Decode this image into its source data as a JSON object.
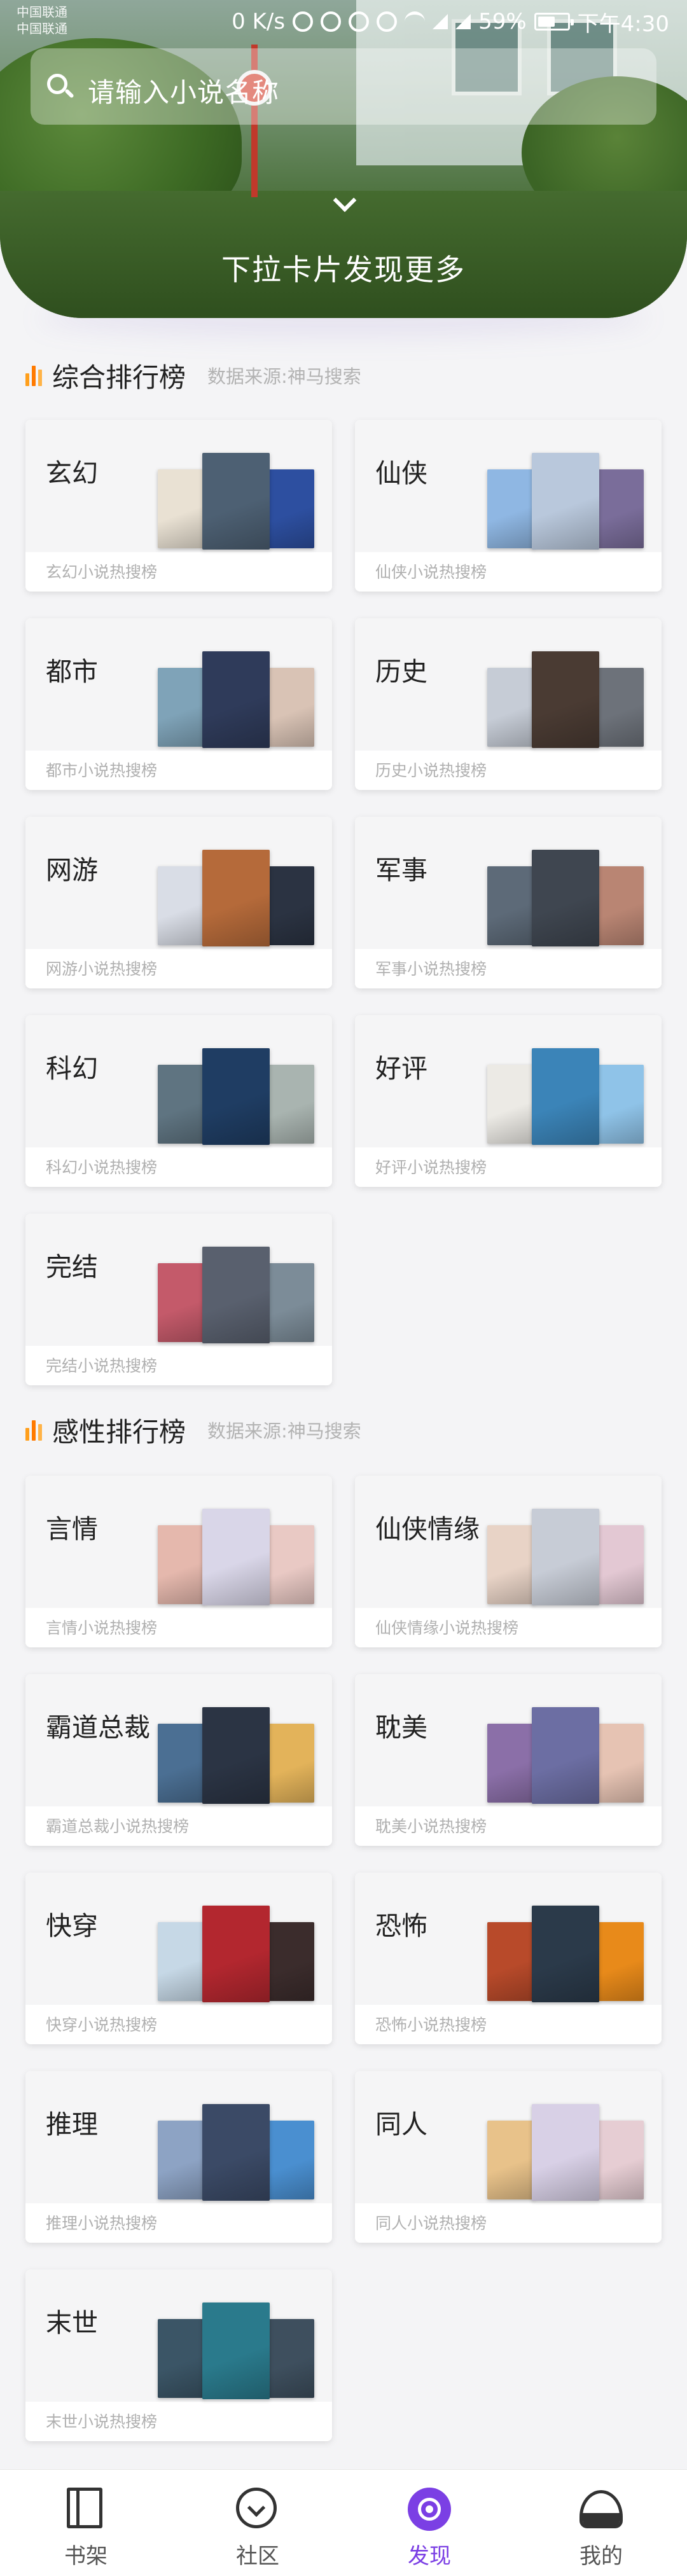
{
  "status_bar": {
    "carrier_1": "中国联通",
    "carrier_2": "中国联通",
    "speed": "0 K/s",
    "battery": "59%",
    "battery_level": 0.59,
    "time": "下午4:30",
    "icons": [
      "location-icon",
      "mute-icon",
      "alarm-icon",
      "eye-icon",
      "wifi-icon",
      "signal-4g-icon",
      "signal-2g-icon",
      "battery-icon"
    ]
  },
  "search": {
    "placeholder": "请输入小说名称"
  },
  "hero": {
    "hint": "下拉卡片发现更多"
  },
  "sections": [
    {
      "title": "综合排行榜",
      "source": "数据来源:神马搜索",
      "cards": [
        {
          "title": "玄幻",
          "sub": "玄幻小说热搜榜",
          "covers": [
            "#e9e1d3",
            "#4d6073",
            "#2d4fa0"
          ]
        },
        {
          "title": "仙侠",
          "sub": "仙侠小说热搜榜",
          "covers": [
            "#8fb7e3",
            "#b9c8dc",
            "#7a6d9a"
          ]
        },
        {
          "title": "都市",
          "sub": "都市小说热搜榜",
          "covers": [
            "#7fa3b8",
            "#2f3b5a",
            "#d9c3b5"
          ]
        },
        {
          "title": "历史",
          "sub": "历史小说热搜榜",
          "covers": [
            "#c6ccd6",
            "#4a3b33",
            "#6d727a"
          ]
        },
        {
          "title": "网游",
          "sub": "网游小说热搜榜",
          "covers": [
            "#d9dde6",
            "#b56a3a",
            "#2b3342"
          ]
        },
        {
          "title": "军事",
          "sub": "军事小说热搜榜",
          "covers": [
            "#5d6a78",
            "#3f4650",
            "#b98573"
          ]
        },
        {
          "title": "科幻",
          "sub": "科幻小说热搜榜",
          "covers": [
            "#5f7481",
            "#1f3d63",
            "#a9b4b0"
          ]
        },
        {
          "title": "好评",
          "sub": "好评小说热搜榜",
          "covers": [
            "#eceae5",
            "#3b84b8",
            "#8fc3e8"
          ]
        },
        {
          "title": "完结",
          "sub": "完结小说热搜榜",
          "covers": [
            "#c45a6a",
            "#59606e",
            "#7c8c98"
          ]
        }
      ]
    },
    {
      "title": "感性排行榜",
      "source": "数据来源:神马搜索",
      "cards": [
        {
          "title": "言情",
          "sub": "言情小说热搜榜",
          "covers": [
            "#e5b8ad",
            "#d9d6e8",
            "#e9c9c4"
          ]
        },
        {
          "title": "仙侠情缘",
          "sub": "仙侠情缘小说热搜榜",
          "covers": [
            "#e8d3c6",
            "#c7ccd6",
            "#e3c8d3"
          ]
        },
        {
          "title": "霸道总裁",
          "sub": "霸道总裁小说热搜榜",
          "covers": [
            "#4b6f93",
            "#2b3444",
            "#e3b35a"
          ]
        },
        {
          "title": "耽美",
          "sub": "耽美小说热搜榜",
          "covers": [
            "#8b6fa8",
            "#6c6ea3",
            "#e6c3b3"
          ]
        },
        {
          "title": "快穿",
          "sub": "快穿小说热搜榜",
          "covers": [
            "#c6d8e6",
            "#b3272f",
            "#3b2c2c"
          ]
        },
        {
          "title": "恐怖",
          "sub": "恐怖小说热搜榜",
          "covers": [
            "#b84a2a",
            "#2b3a4a",
            "#e88a1a"
          ]
        },
        {
          "title": "推理",
          "sub": "推理小说热搜榜",
          "covers": [
            "#8da3c4",
            "#3b4a66",
            "#4a8fd0"
          ]
        },
        {
          "title": "同人",
          "sub": "同人小说热搜榜",
          "covers": [
            "#e8c28a",
            "#d8d0e6",
            "#e6cdd3"
          ]
        },
        {
          "title": "末世",
          "sub": "末世小说热搜榜",
          "covers": [
            "#3b5566",
            "#2a7a8c",
            "#3e4f5e"
          ]
        }
      ]
    }
  ],
  "bottom_nav": {
    "items": [
      {
        "label": "书架",
        "icon": "bookshelf-icon"
      },
      {
        "label": "社区",
        "icon": "community-icon"
      },
      {
        "label": "发现",
        "icon": "discover-icon",
        "active": true
      },
      {
        "label": "我的",
        "icon": "profile-icon"
      }
    ]
  },
  "colors": {
    "accent": "#7b3fe4",
    "section_bar_icon": "#ff7a00"
  }
}
